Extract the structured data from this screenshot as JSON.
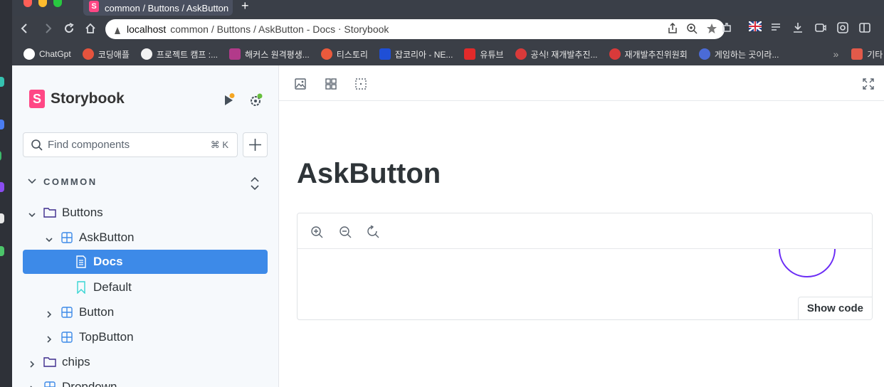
{
  "browser": {
    "tab_title": "common / Buttons / AskButton",
    "tab_favicon_letter": "S",
    "new_tab_label": "+",
    "url_host": "localhost",
    "url_rest": "common / Buttons / AskButton - Docs ⋅ Storybook"
  },
  "bookmarks": [
    {
      "label": "ChatGpt",
      "color": "#ffffff"
    },
    {
      "label": "코딩애플",
      "color": "#e5533d"
    },
    {
      "label": "프로젝트 캠프 :...",
      "color": "#f2f2f2"
    },
    {
      "label": "해커스 원격평생...",
      "color": "#b23a8a"
    },
    {
      "label": "티스토리",
      "color": "#ea5a3c"
    },
    {
      "label": "잡코리아 - NE...",
      "color": "#1f4fd6"
    },
    {
      "label": "유튜브",
      "color": "#e22a2a"
    },
    {
      "label": "공식! 재개발추진...",
      "color": "#d93a3a"
    },
    {
      "label": "재개발추진위원회",
      "color": "#d93a3a"
    },
    {
      "label": "게임하는 곳이라...",
      "color": "#4b6bd6"
    }
  ],
  "bookmarks_folder": "기타",
  "sidebar": {
    "brand": "Storybook",
    "logo_letter": "S",
    "search_placeholder": "Find components",
    "search_shortcut": "⌘ K",
    "section": "COMMON",
    "tree": [
      {
        "label": "Buttons",
        "level": 0,
        "kind": "folder",
        "expanded": true
      },
      {
        "label": "AskButton",
        "level": 1,
        "kind": "component",
        "expanded": true
      },
      {
        "label": "Docs",
        "level": 2,
        "kind": "docs",
        "selected": true
      },
      {
        "label": "Default",
        "level": 2,
        "kind": "story"
      },
      {
        "label": "Button",
        "level": 1,
        "kind": "component",
        "expanded": false
      },
      {
        "label": "TopButton",
        "level": 1,
        "kind": "component",
        "expanded": false
      },
      {
        "label": "chips",
        "level": 0,
        "kind": "folder",
        "expanded": false
      },
      {
        "label": "Dropdown",
        "level": 0,
        "kind": "component",
        "expanded": false
      }
    ]
  },
  "main": {
    "title": "AskButton",
    "show_code": "Show code"
  },
  "colors": {
    "accent": "#3d8ae8",
    "brand": "#ff4785",
    "ask_button": "#7c33f0"
  }
}
